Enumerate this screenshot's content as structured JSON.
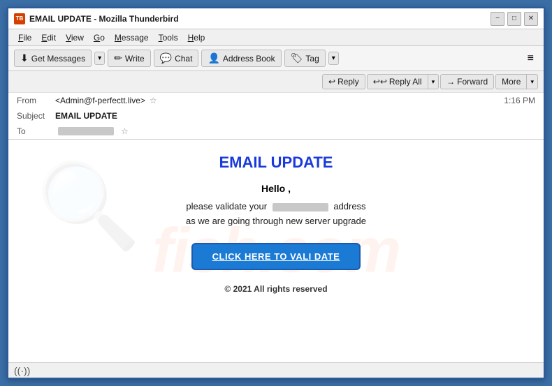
{
  "window": {
    "title": "EMAIL UPDATE - Mozilla Thunderbird",
    "icon_label": "TB"
  },
  "window_controls": {
    "minimize": "−",
    "maximize": "□",
    "close": "✕"
  },
  "menu": {
    "items": [
      "File",
      "Edit",
      "View",
      "Go",
      "Message",
      "Tools",
      "Help"
    ]
  },
  "toolbar": {
    "get_messages_label": "Get Messages",
    "write_label": "Write",
    "chat_label": "Chat",
    "address_book_label": "Address Book",
    "tag_label": "Tag",
    "menu_icon": "≡"
  },
  "email_actions": {
    "reply_label": "Reply",
    "reply_all_label": "Reply All",
    "forward_label": "Forward",
    "more_label": "More"
  },
  "email_header": {
    "from_label": "From",
    "from_value": "<Admin@f-perfectt.live>",
    "subject_label": "Subject",
    "subject_value": "EMAIL UPDATE",
    "to_label": "To",
    "time": "1:16 PM"
  },
  "email_body": {
    "title": "EMAIL UPDATE",
    "hello_text": "Hello ,",
    "body_line1_pre": "please validate your",
    "body_line1_post": "address",
    "body_line2": "as we are going through new server upgrade",
    "validate_btn": "CLICK HERE TO VALI DATE",
    "footer": "© 2021 All rights reserved",
    "watermark": "fish.com"
  },
  "status_bar": {
    "icon": "((·))",
    "text": ""
  }
}
